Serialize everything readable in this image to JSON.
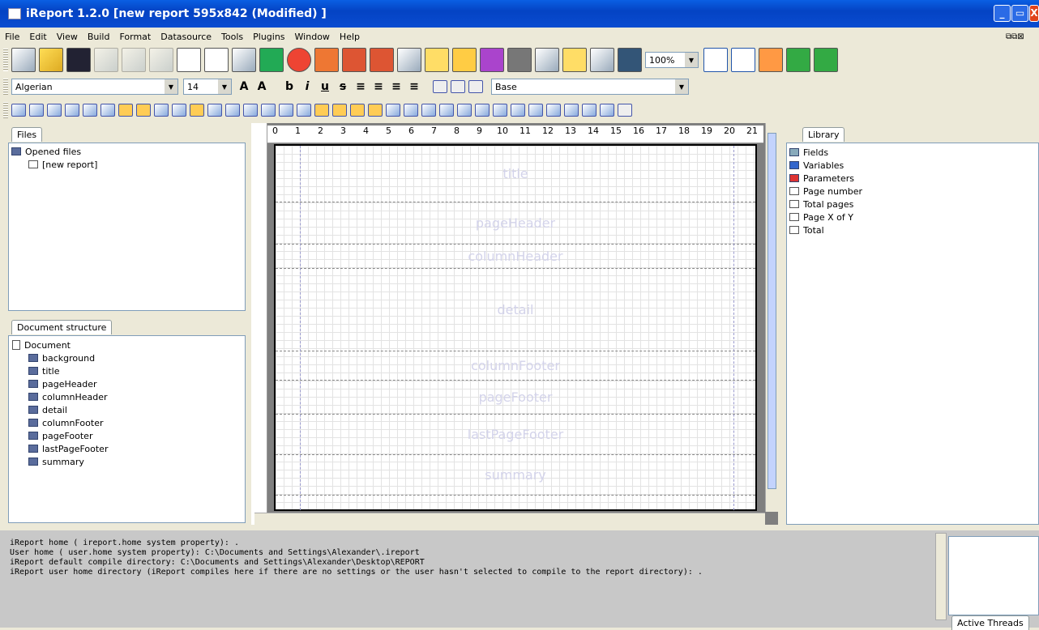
{
  "window": {
    "title": "iReport 1.2.0  [new report 595x842 (Modified) ]"
  },
  "menu": [
    "File",
    "Edit",
    "View",
    "Build",
    "Format",
    "Datasource",
    "Tools",
    "Plugins",
    "Window",
    "Help"
  ],
  "toolbar": {
    "zoom": "100%"
  },
  "format": {
    "font": "Algerian",
    "size": "14",
    "style": "Base",
    "bold": "b",
    "italic": "i",
    "underline": "u",
    "strike": "s"
  },
  "files": {
    "tab": "Files",
    "root": "Opened files",
    "item": "[new report]"
  },
  "structure": {
    "tab": "Document structure",
    "root": "Document",
    "items": [
      "background",
      "title",
      "pageHeader",
      "columnHeader",
      "detail",
      "columnFooter",
      "pageFooter",
      "lastPageFooter",
      "summary"
    ]
  },
  "bands": [
    "title",
    "pageHeader",
    "columnHeader",
    "detail",
    "columnFooter",
    "pageFooter",
    "lastPageFooter",
    "summary"
  ],
  "ruler": [
    "0",
    "1",
    "2",
    "3",
    "4",
    "5",
    "6",
    "7",
    "8",
    "9",
    "10",
    "11",
    "12",
    "13",
    "14",
    "15",
    "16",
    "17",
    "18",
    "19",
    "20",
    "21"
  ],
  "library": {
    "tab": "Library",
    "items": [
      "Fields",
      "Variables",
      "Parameters",
      "Page number",
      "Total pages",
      "Page X of Y",
      "Total"
    ]
  },
  "console": {
    "lines": [
      "iReport home ( ireport.home system property): .",
      "User home ( user.home system property): C:\\Documents and Settings\\Alexander\\.ireport",
      "iReport default compile directory: C:\\Documents and Settings\\Alexander\\Desktop\\REPORT",
      "iReport user home directory (iReport compiles here if there are no settings or the user hasn't selected to compile to the report directory): ."
    ]
  },
  "threads": {
    "tab": "Active Threads"
  }
}
